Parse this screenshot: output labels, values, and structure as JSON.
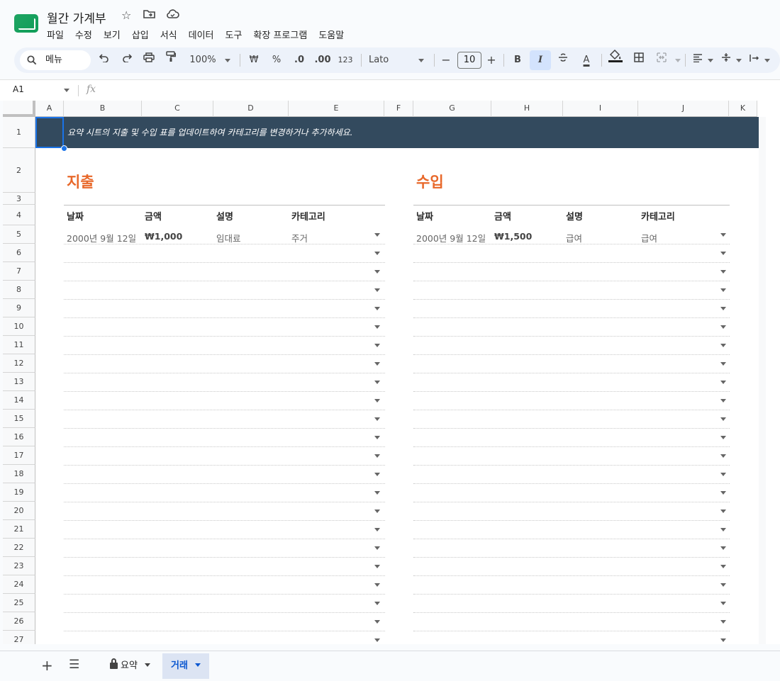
{
  "doc": {
    "title": "월간 가계부"
  },
  "menu": [
    "파일",
    "수정",
    "보기",
    "삽입",
    "서식",
    "데이터",
    "도구",
    "확장 프로그램",
    "도움말"
  ],
  "toolbar": {
    "search_label": "메뉴",
    "zoom": "100%",
    "currency": "₩",
    "percent": "%",
    "dec_decrease": ".0",
    "dec_increase": ".00",
    "number_format": "123",
    "font": "Lato",
    "font_size": "10",
    "bold": "B",
    "italic": "I",
    "text_color": "A"
  },
  "formula_bar": {
    "cell_ref": "A1",
    "fx": "fx"
  },
  "columns": [
    "A",
    "B",
    "C",
    "D",
    "E",
    "F",
    "G",
    "H",
    "I",
    "J",
    "K"
  ],
  "rows": [
    "1",
    "2",
    "3",
    "4",
    "5",
    "6",
    "7",
    "8",
    "9",
    "10",
    "11",
    "12",
    "13",
    "14",
    "15",
    "16",
    "17",
    "18",
    "19",
    "20",
    "21",
    "22",
    "23",
    "24",
    "25",
    "26",
    "27"
  ],
  "banner": "요약 시트의 지출 및 수입 표를 업데이트하여 카테고리를 변경하거나 추가하세요.",
  "expenses": {
    "title": "지출",
    "headers": [
      "날짜",
      "금액",
      "설명",
      "카테고리"
    ],
    "first_row": {
      "date": "2000년 9월 12일",
      "amount": "₩1,000",
      "description": "임대료",
      "category": "주거"
    }
  },
  "income": {
    "title": "수입",
    "headers": [
      "날짜",
      "금액",
      "설명",
      "카테고리"
    ],
    "first_row": {
      "date": "2000년 9월 12일",
      "amount": "₩1,500",
      "description": "급여",
      "category": "급여"
    }
  },
  "sheet_tabs": {
    "summary": "요약",
    "transactions": "거래"
  }
}
